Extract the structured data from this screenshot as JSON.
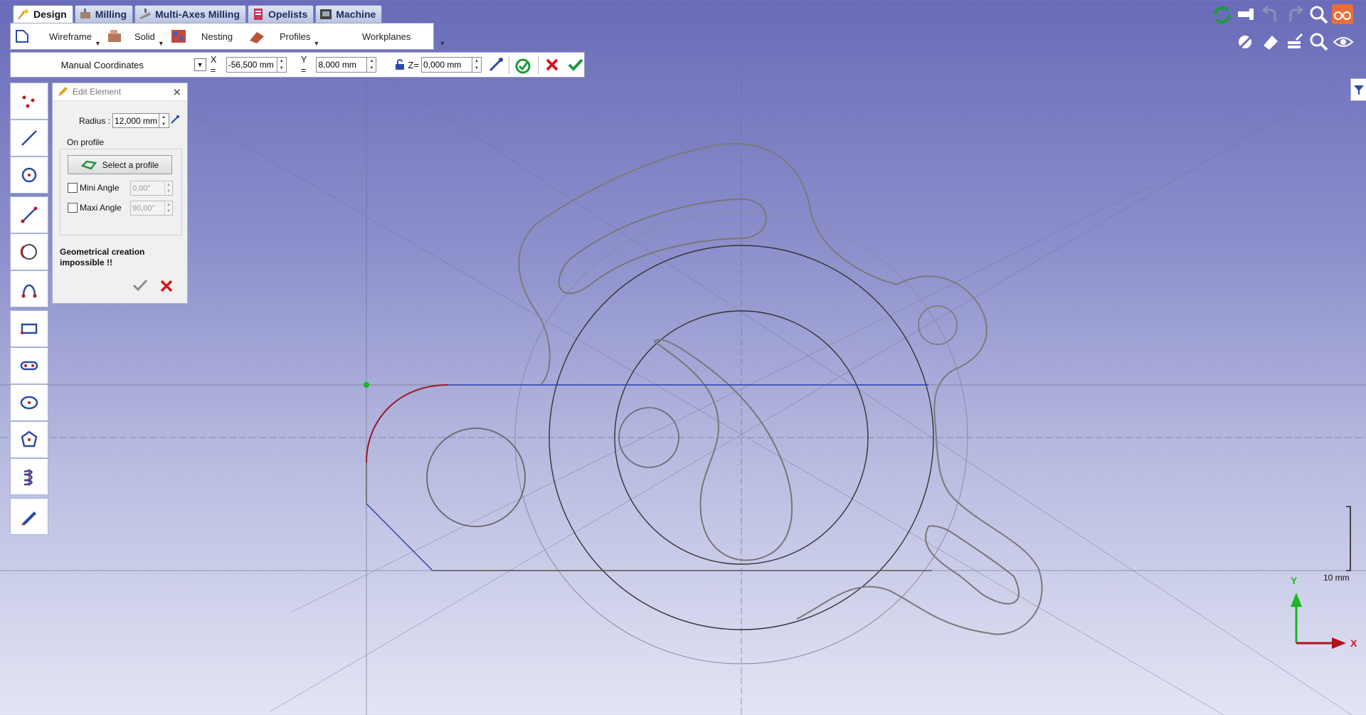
{
  "tabs": [
    {
      "label": "Design",
      "icon": "design-icon",
      "active": true
    },
    {
      "label": "Milling",
      "icon": "milling-icon"
    },
    {
      "label": "Multi-Axes Milling",
      "icon": "multi-axes-icon"
    },
    {
      "label": "Opelists",
      "icon": "opelists-icon"
    },
    {
      "label": "Machine",
      "icon": "machine-icon"
    }
  ],
  "ribbon": {
    "wireframe": "Wireframe",
    "solid": "Solid",
    "nesting": "Nesting",
    "profiles": "Profiles",
    "workplanes": "Workplanes"
  },
  "coords": {
    "mode": "Manual Coordinates",
    "x_label": "X =",
    "x_value": "-56,500 mm",
    "y_label": "Y =",
    "y_value": "8,000 mm",
    "z_label": "Z=",
    "z_value": "0,000 mm"
  },
  "edit_panel": {
    "title": "Edit Element",
    "radius_label": "Radius :",
    "radius_value": "12,000 mm",
    "group_label": "On profile",
    "select_profile": "Select a profile",
    "mini_angle_label": "Mini Angle",
    "mini_angle_value": "0,00°",
    "maxi_angle_label": "Maxi Angle",
    "maxi_angle_value": "90,00°",
    "message": "Geometrical creation impossible !!"
  },
  "scale_label": "10 mm",
  "axes": {
    "y": "Y",
    "x": "X"
  },
  "colors": {
    "accent_green": "#1a9a3a",
    "cancel_red": "#d11a1a",
    "profile_red": "#9b1a2a",
    "line_blue": "#2b3fae"
  }
}
